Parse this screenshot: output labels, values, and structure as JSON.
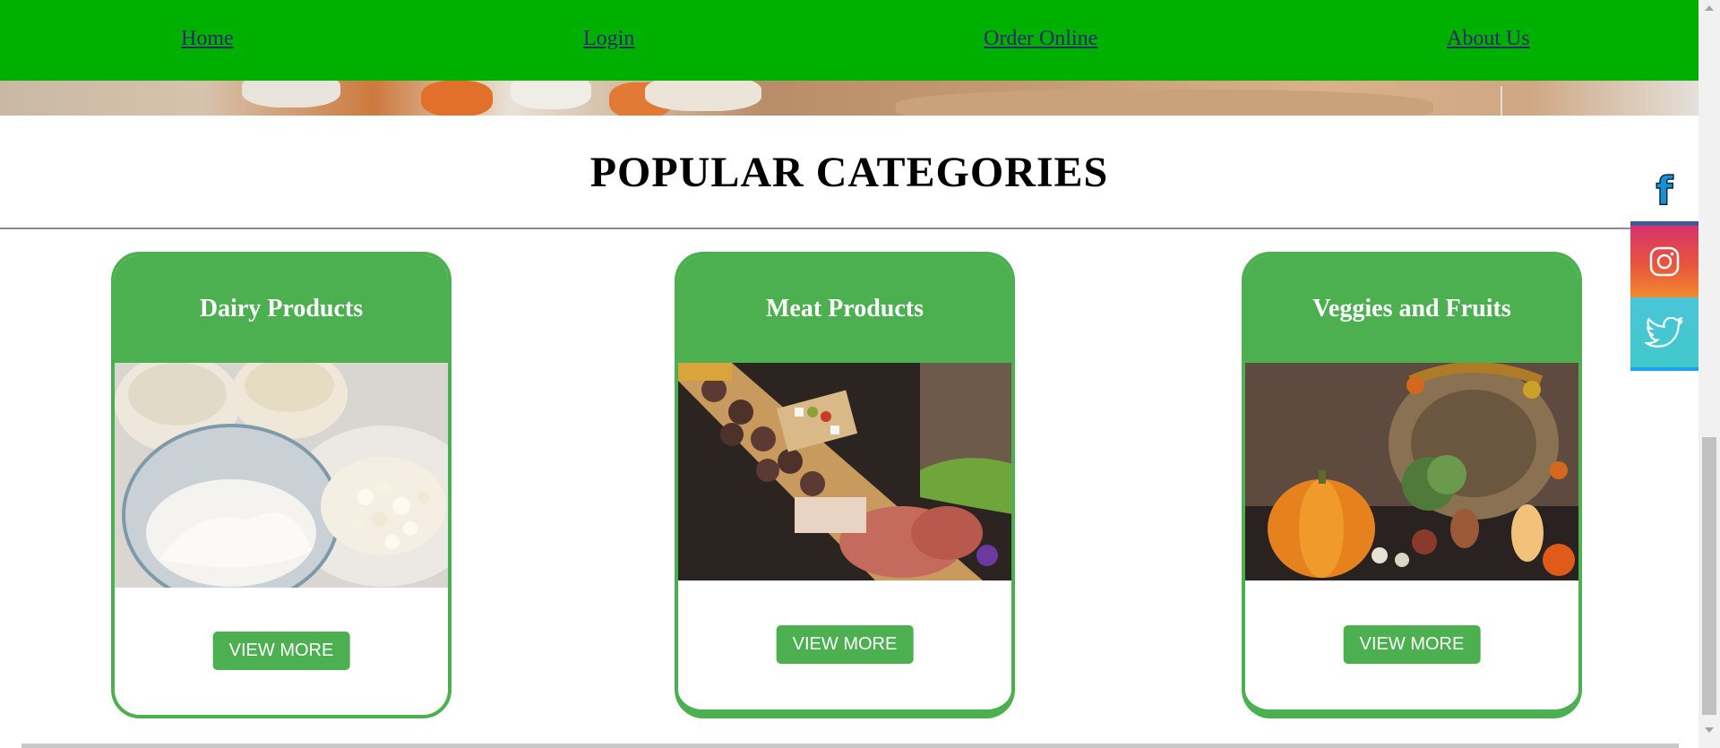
{
  "nav": {
    "items": [
      "Home",
      "Login",
      "Order Online",
      "About Us"
    ]
  },
  "section": {
    "title": "POPULAR CATEGORIES"
  },
  "cards": [
    {
      "title": "Dairy Products",
      "button": "VIEW MORE"
    },
    {
      "title": "Meat Products",
      "button": "VIEW MORE"
    },
    {
      "title": "Veggies and Fruits",
      "button": "VIEW MORE"
    }
  ],
  "social": {
    "facebook_letter": "f",
    "icons": [
      "facebook-icon",
      "instagram-icon",
      "twitter-icon"
    ]
  },
  "colors": {
    "nav_bg": "#00b000",
    "card_green": "#4caf50",
    "link": "#2a2a6a"
  }
}
